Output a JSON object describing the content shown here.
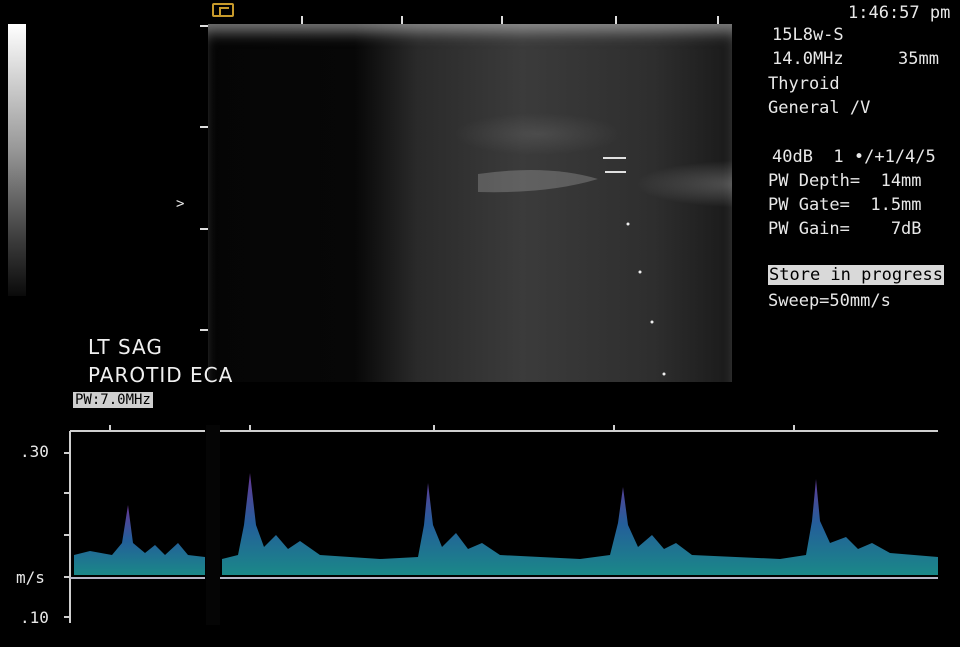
{
  "clock": "1:46:57 pm",
  "probe": {
    "model": "15L8w-S",
    "frequency": "14.0MHz",
    "depth": "35mm",
    "preset": "Thyroid",
    "mode": "General /V"
  },
  "settings": {
    "gain_line": "40dB  1 •/+1/4/5",
    "pw_depth": "PW Depth=  14mm",
    "pw_gate": "PW Gate=  1.5mm",
    "pw_gain": "PW Gain=    7dB"
  },
  "status": {
    "store": "Store in progress",
    "sweep": "Sweep=50mm/s"
  },
  "annotation": {
    "line1": "LT SAG",
    "line2": "PAROTID ECA"
  },
  "pw_label": "PW:7.0MHz",
  "doppler": {
    "tick_top": ".30",
    "unit": "m/s",
    "tick_bottom": ".10"
  },
  "colors": {
    "spectrum_low": "#1fa0a0",
    "spectrum_high": "#7a3fb0",
    "orientation_marker": "#c79a2b",
    "baseline": "#b8b8c8"
  },
  "icons": {
    "orientation_marker": "probe-orientation-icon",
    "focus_marker": "focus-arrow-icon"
  }
}
